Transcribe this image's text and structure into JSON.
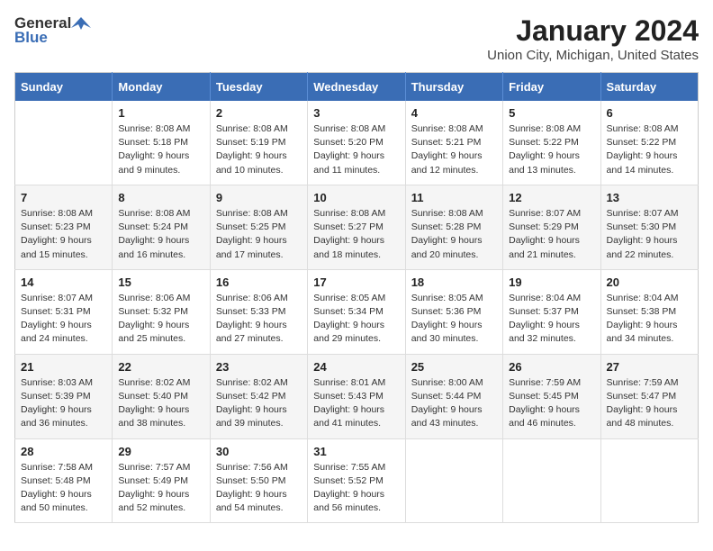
{
  "header": {
    "logo_general": "General",
    "logo_blue": "Blue",
    "month": "January 2024",
    "location": "Union City, Michigan, United States"
  },
  "weekdays": [
    "Sunday",
    "Monday",
    "Tuesday",
    "Wednesday",
    "Thursday",
    "Friday",
    "Saturday"
  ],
  "weeks": [
    [
      {
        "day": "",
        "info": ""
      },
      {
        "day": "1",
        "info": "Sunrise: 8:08 AM\nSunset: 5:18 PM\nDaylight: 9 hours\nand 9 minutes."
      },
      {
        "day": "2",
        "info": "Sunrise: 8:08 AM\nSunset: 5:19 PM\nDaylight: 9 hours\nand 10 minutes."
      },
      {
        "day": "3",
        "info": "Sunrise: 8:08 AM\nSunset: 5:20 PM\nDaylight: 9 hours\nand 11 minutes."
      },
      {
        "day": "4",
        "info": "Sunrise: 8:08 AM\nSunset: 5:21 PM\nDaylight: 9 hours\nand 12 minutes."
      },
      {
        "day": "5",
        "info": "Sunrise: 8:08 AM\nSunset: 5:22 PM\nDaylight: 9 hours\nand 13 minutes."
      },
      {
        "day": "6",
        "info": "Sunrise: 8:08 AM\nSunset: 5:22 PM\nDaylight: 9 hours\nand 14 minutes."
      }
    ],
    [
      {
        "day": "7",
        "info": "Sunrise: 8:08 AM\nSunset: 5:23 PM\nDaylight: 9 hours\nand 15 minutes."
      },
      {
        "day": "8",
        "info": "Sunrise: 8:08 AM\nSunset: 5:24 PM\nDaylight: 9 hours\nand 16 minutes."
      },
      {
        "day": "9",
        "info": "Sunrise: 8:08 AM\nSunset: 5:25 PM\nDaylight: 9 hours\nand 17 minutes."
      },
      {
        "day": "10",
        "info": "Sunrise: 8:08 AM\nSunset: 5:27 PM\nDaylight: 9 hours\nand 18 minutes."
      },
      {
        "day": "11",
        "info": "Sunrise: 8:08 AM\nSunset: 5:28 PM\nDaylight: 9 hours\nand 20 minutes."
      },
      {
        "day": "12",
        "info": "Sunrise: 8:07 AM\nSunset: 5:29 PM\nDaylight: 9 hours\nand 21 minutes."
      },
      {
        "day": "13",
        "info": "Sunrise: 8:07 AM\nSunset: 5:30 PM\nDaylight: 9 hours\nand 22 minutes."
      }
    ],
    [
      {
        "day": "14",
        "info": "Sunrise: 8:07 AM\nSunset: 5:31 PM\nDaylight: 9 hours\nand 24 minutes."
      },
      {
        "day": "15",
        "info": "Sunrise: 8:06 AM\nSunset: 5:32 PM\nDaylight: 9 hours\nand 25 minutes."
      },
      {
        "day": "16",
        "info": "Sunrise: 8:06 AM\nSunset: 5:33 PM\nDaylight: 9 hours\nand 27 minutes."
      },
      {
        "day": "17",
        "info": "Sunrise: 8:05 AM\nSunset: 5:34 PM\nDaylight: 9 hours\nand 29 minutes."
      },
      {
        "day": "18",
        "info": "Sunrise: 8:05 AM\nSunset: 5:36 PM\nDaylight: 9 hours\nand 30 minutes."
      },
      {
        "day": "19",
        "info": "Sunrise: 8:04 AM\nSunset: 5:37 PM\nDaylight: 9 hours\nand 32 minutes."
      },
      {
        "day": "20",
        "info": "Sunrise: 8:04 AM\nSunset: 5:38 PM\nDaylight: 9 hours\nand 34 minutes."
      }
    ],
    [
      {
        "day": "21",
        "info": "Sunrise: 8:03 AM\nSunset: 5:39 PM\nDaylight: 9 hours\nand 36 minutes."
      },
      {
        "day": "22",
        "info": "Sunrise: 8:02 AM\nSunset: 5:40 PM\nDaylight: 9 hours\nand 38 minutes."
      },
      {
        "day": "23",
        "info": "Sunrise: 8:02 AM\nSunset: 5:42 PM\nDaylight: 9 hours\nand 39 minutes."
      },
      {
        "day": "24",
        "info": "Sunrise: 8:01 AM\nSunset: 5:43 PM\nDaylight: 9 hours\nand 41 minutes."
      },
      {
        "day": "25",
        "info": "Sunrise: 8:00 AM\nSunset: 5:44 PM\nDaylight: 9 hours\nand 43 minutes."
      },
      {
        "day": "26",
        "info": "Sunrise: 7:59 AM\nSunset: 5:45 PM\nDaylight: 9 hours\nand 46 minutes."
      },
      {
        "day": "27",
        "info": "Sunrise: 7:59 AM\nSunset: 5:47 PM\nDaylight: 9 hours\nand 48 minutes."
      }
    ],
    [
      {
        "day": "28",
        "info": "Sunrise: 7:58 AM\nSunset: 5:48 PM\nDaylight: 9 hours\nand 50 minutes."
      },
      {
        "day": "29",
        "info": "Sunrise: 7:57 AM\nSunset: 5:49 PM\nDaylight: 9 hours\nand 52 minutes."
      },
      {
        "day": "30",
        "info": "Sunrise: 7:56 AM\nSunset: 5:50 PM\nDaylight: 9 hours\nand 54 minutes."
      },
      {
        "day": "31",
        "info": "Sunrise: 7:55 AM\nSunset: 5:52 PM\nDaylight: 9 hours\nand 56 minutes."
      },
      {
        "day": "",
        "info": ""
      },
      {
        "day": "",
        "info": ""
      },
      {
        "day": "",
        "info": ""
      }
    ]
  ]
}
